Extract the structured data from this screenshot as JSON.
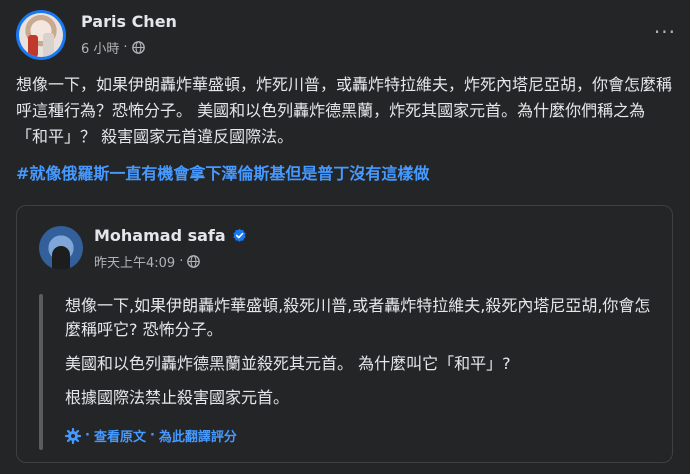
{
  "post": {
    "author": "Paris Chen",
    "time": "6 小時",
    "separator": "·",
    "more": "···",
    "text": "想像一下，如果伊朗轟炸華盛頓，炸死川普，或轟炸特拉維夫，炸死內塔尼亞胡，你會怎麼稱呼這種行為？恐怖分子。 美國和以色列轟炸德黑蘭，炸死其國家元首。為什麼你們稱之為「和平」？ 殺害國家元首違反國際法。",
    "hashtag": "#就像俄羅斯一直有機會拿下澤倫斯基但是普丁沒有這樣做"
  },
  "shared": {
    "author": "Mohamad safa",
    "time": "昨天上午4:09",
    "separator": "·",
    "paragraphs": [
      "想像一下,如果伊朗轟炸華盛頓,殺死川普,或者轟炸特拉維夫,殺死內塔尼亞胡,你會怎麼稱呼它? 恐怖分子。",
      "美國和以色列轟炸德黑蘭並殺死其元首。 為什麼叫它「和平」?",
      "根據國際法禁止殺害國家元首。"
    ],
    "translate_sep": "·",
    "see_original": "查看原文",
    "rate_translation": "為此翻譯評分"
  },
  "colors": {
    "background": "#242526",
    "text": "#e4e6eb",
    "secondary": "#b0b3b8",
    "link": "#4599ff",
    "verified": "#1877f2"
  },
  "icons": [
    "globe-icon",
    "more-icon",
    "verified-icon",
    "gear-icon"
  ]
}
